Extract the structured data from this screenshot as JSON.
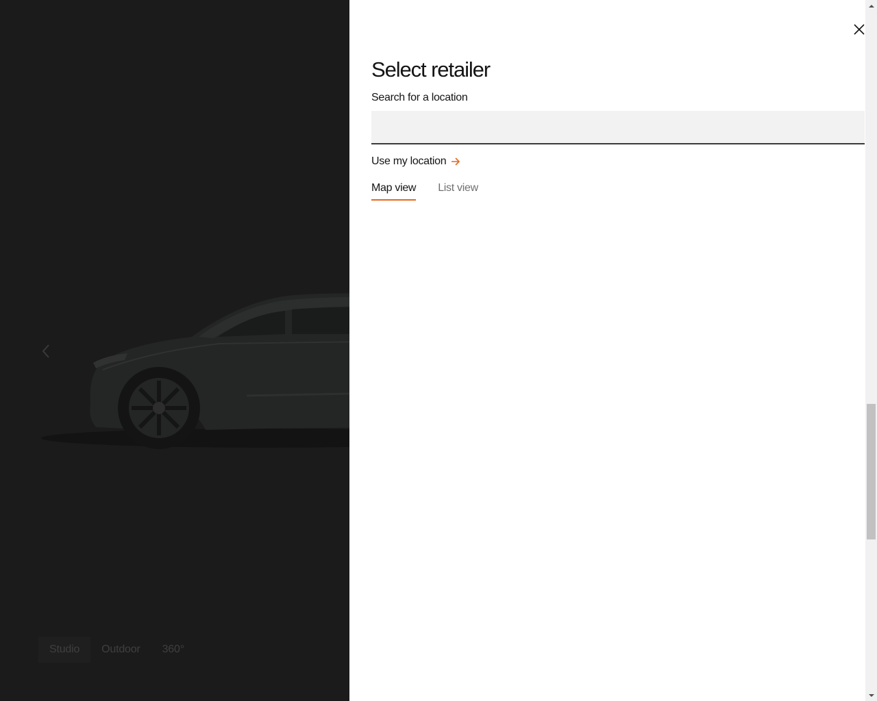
{
  "configurator": {
    "view_tabs": [
      {
        "label": "Studio"
      },
      {
        "label": "Outdoor"
      },
      {
        "label": "360°"
      }
    ],
    "prev_icon": "chevron-left-icon"
  },
  "retailer_panel": {
    "title": "Select retailer",
    "search_label": "Search for a location",
    "search_value": "",
    "search_placeholder": "",
    "use_location_label": "Use my location",
    "use_location_icon": "arrow-right-icon",
    "tabs": [
      {
        "label": "Map view",
        "active": true
      },
      {
        "label": "List view",
        "active": false
      }
    ],
    "close_icon": "close-icon"
  },
  "colors": {
    "accent": "#e8671d",
    "backdrop": "#1b1b1b",
    "panel": "#ffffff",
    "input_bg": "#f1f2f1"
  }
}
